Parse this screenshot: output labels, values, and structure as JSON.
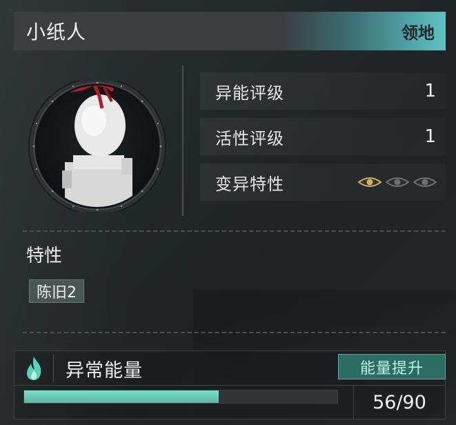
{
  "header": {
    "title": "小纸人",
    "territory_label": "领地"
  },
  "stats": [
    {
      "label": "异能评级",
      "value": "1"
    },
    {
      "label": "活性评级",
      "value": "1"
    },
    {
      "label": "变异特性",
      "eyes_active": 1,
      "eyes_total": 3
    }
  ],
  "traits": {
    "title": "特性",
    "tags": [
      "陈旧2"
    ]
  },
  "energy": {
    "label": "异常能量",
    "boost_label": "能量提升",
    "current": 56,
    "max": 90,
    "display": "56/90"
  },
  "colors": {
    "accent": "#5fc2c6",
    "eye_active": "#c9b36a",
    "eye_inactive": "#6d7275",
    "bar_fill": "#6ccfb8",
    "flame": "#58d3b8"
  },
  "icons": [
    "paper-doll-portrait",
    "eye-icon",
    "flame-icon"
  ]
}
